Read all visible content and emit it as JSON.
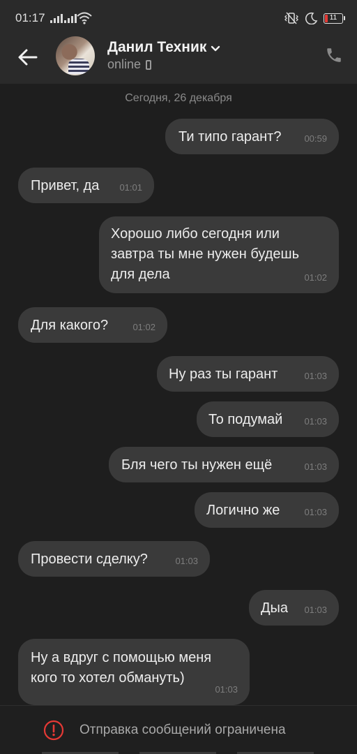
{
  "status_bar": {
    "time": "01:17",
    "battery": "11",
    "icons": [
      "signal-icon",
      "signal-icon",
      "wifi-icon",
      "vibrate-icon",
      "moon-icon",
      "battery-icon"
    ]
  },
  "header": {
    "contact_name": "Данил Техник",
    "status": "online",
    "icons": [
      "back-arrow-icon",
      "chevron-down-icon",
      "mobile-device-icon",
      "phone-icon"
    ]
  },
  "chat": {
    "date_separator": "Сегодня, 26 декабря",
    "messages": [
      {
        "direction": "out",
        "text": "Ти типо гарант?",
        "time": "00:59"
      },
      {
        "direction": "in",
        "text": "Привет, да",
        "time": "01:01"
      },
      {
        "direction": "out",
        "lines": [
          "Хорошо либо сегодня или",
          "завтра ты мне нужен будешь",
          "для дела"
        ],
        "time": "01:02"
      },
      {
        "direction": "in",
        "text": "Для какого?",
        "time": "01:02"
      },
      {
        "direction": "out",
        "text": "Ну раз ты гарант",
        "time": "01:03"
      },
      {
        "direction": "out",
        "text": "То подумай",
        "time": "01:03"
      },
      {
        "direction": "out",
        "text": "Бля чего ты нужен ещё",
        "time": "01:03"
      },
      {
        "direction": "out",
        "text": "Логично же",
        "time": "01:03"
      },
      {
        "direction": "in",
        "text": "Провести сделку?",
        "time": "01:03"
      },
      {
        "direction": "out",
        "text": "Дыа",
        "time": "01:03"
      },
      {
        "direction": "in",
        "lines": [
          "Ну а вдруг с помощью меня",
          "кого то хотел обмануть)"
        ],
        "time": "01:03"
      }
    ]
  },
  "footer": {
    "notice": "Отправка сообщений ограничена",
    "icon": "warning-icon"
  },
  "colors": {
    "background": "#1e1e1e",
    "bar": "#2a2a2a",
    "bubble": "#3a3a3a",
    "warning": "#e53935"
  }
}
